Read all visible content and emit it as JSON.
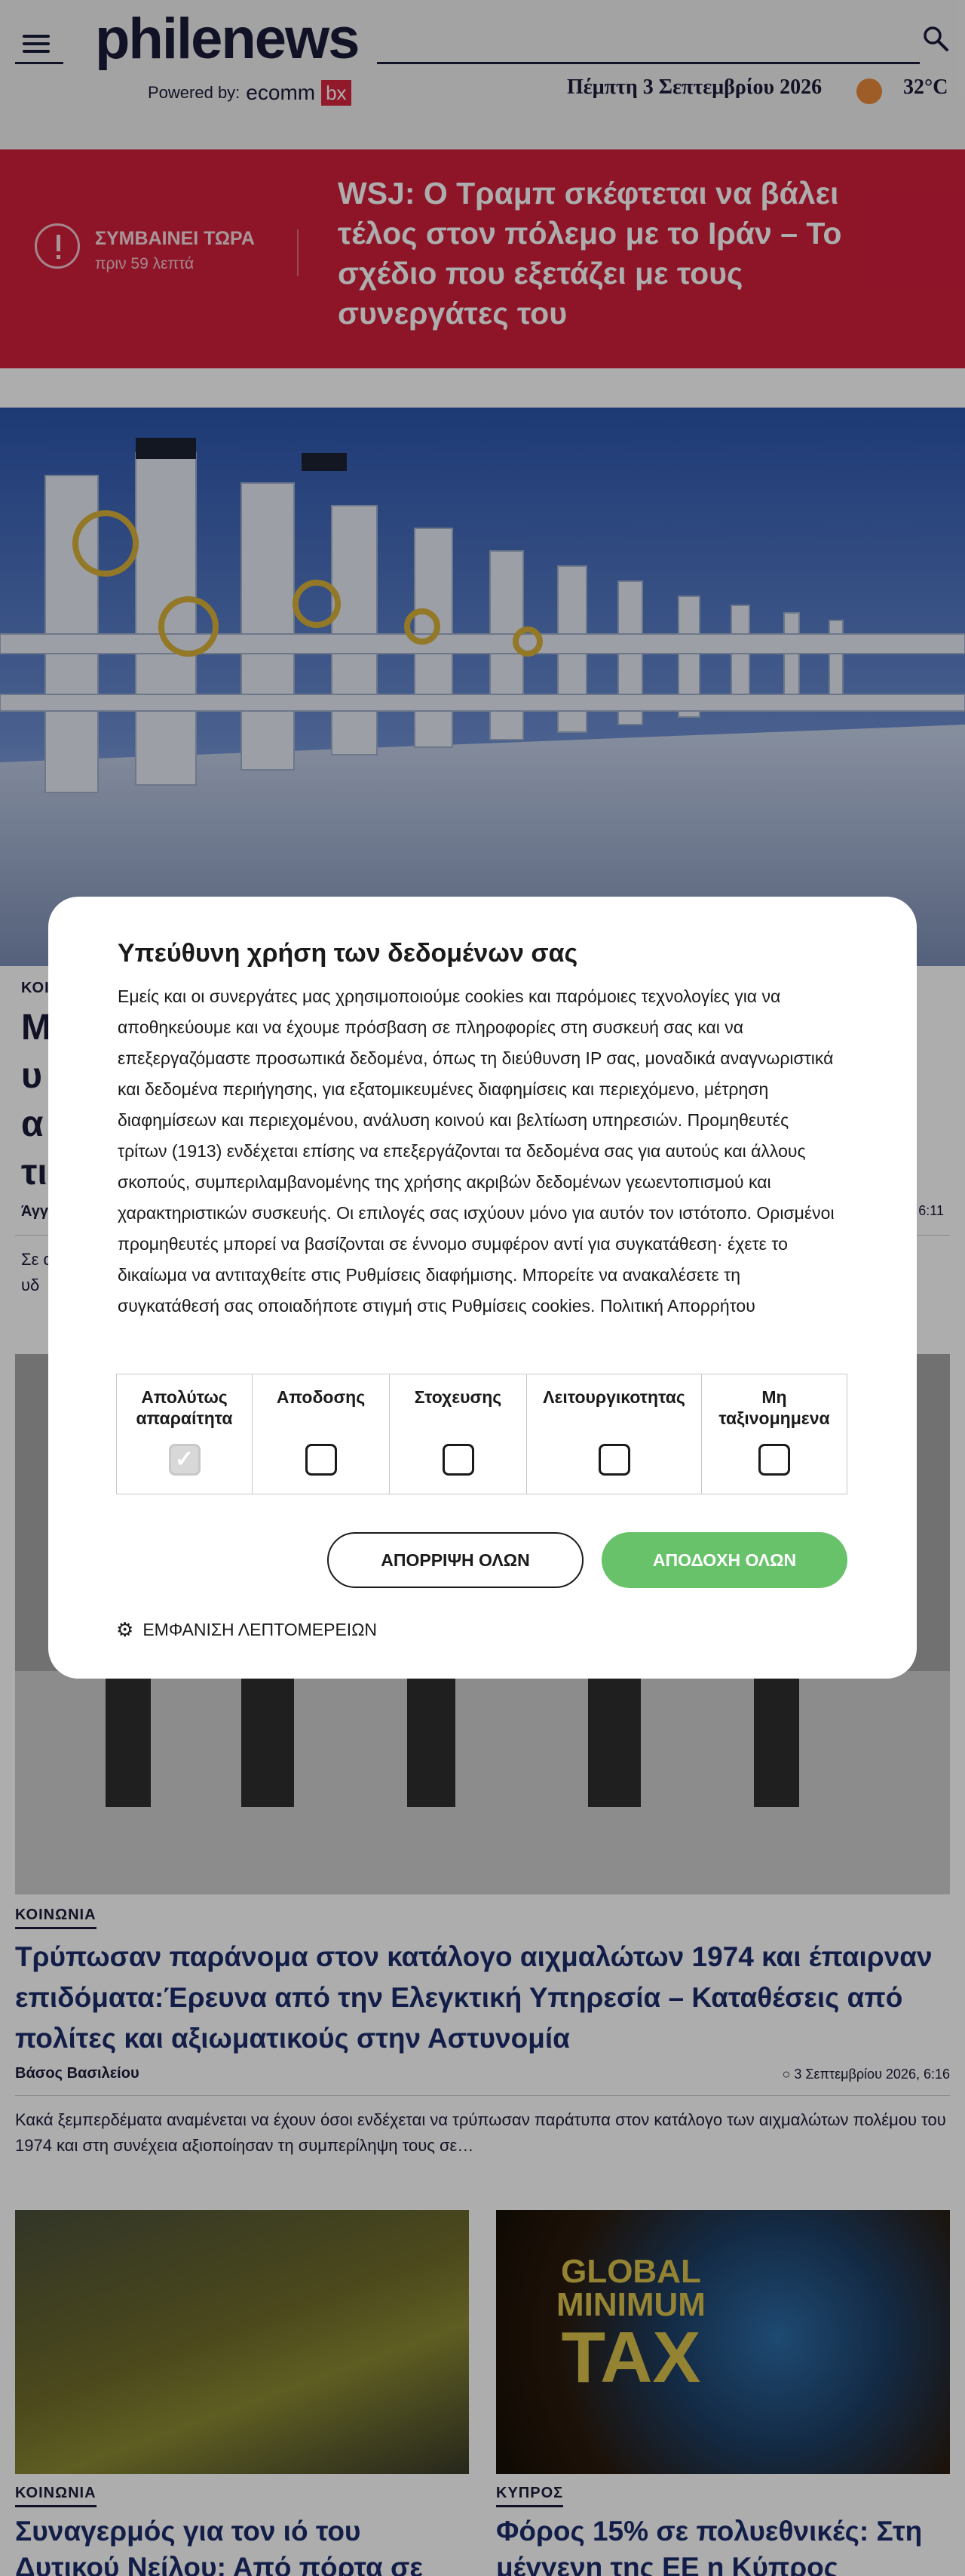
{
  "header": {
    "logo": "philenews",
    "powered_by": "Powered by:",
    "sponsor_main": "ecomm",
    "sponsor_badge": "bx",
    "date": "Πέμπτη 3 Σεπτεμβρίου 2026",
    "temperature": "32°C"
  },
  "breaking": {
    "label": "ΣΥΜΒΑΙΝΕΙ ΤΩΡΑ",
    "time": "πριν 59 λεπτά",
    "headline": "WSJ: Ο Τραμπ σκέφτεται να βάλει τέλος στον πόλεμο με το Ιράν – Το σχέδιο που εξετάζει με τους συνεργάτες του"
  },
  "article_main": {
    "category": "ΚΟΙ",
    "title": "Μ\nυ\nα\nτι",
    "author": "Άγγ",
    "time": "6:11",
    "excerpt": "Σε α\nυδ"
  },
  "article_second": {
    "category": "ΚΟΙΝΩΝΙΑ",
    "title": "Τρύπωσαν παράνομα στον κατάλογο αιχμαλώτων 1974 και έπαιρναν επιδόματα:Έρευνα από την Ελεγκτική Υπηρεσία – Καταθέσεις από πολίτες και αξιωματικούς στην Αστυνομία",
    "author": "Βάσος Βασιλείου",
    "time": "3 Σεπτεμβρίου 2026, 6:16",
    "excerpt": "Κακά ξεμπερδέματα αναμένεται να έχουν όσοι ενδέχεται να τρύπωσαν παράτυπα στον κατάλογο των αιχμαλώτων πολέμου του 1974 και στη συνέχεια αξιοποίησαν τη συμπερίληψη τους σε…"
  },
  "cards": [
    {
      "category": "ΚΟΙΝΩΝΙΑ",
      "title": "Συναγερμός για τον ιό του Δυτικού Νείλου: Από πόρτα σε"
    },
    {
      "category": "ΚΥΠΡΟΣ",
      "title": "Φόρος 15% σε πολυεθνικές: Στη μέγγενη της ΕΕ η Κύπρος",
      "image_text": [
        "GLOBAL",
        "MINIMUM",
        "TAX"
      ]
    }
  ],
  "cookie_modal": {
    "title": "Υπεύθυνη χρήση των δεδομένων σας",
    "text": "Εμείς και οι συνεργάτες μας χρησιμοποιούμε cookies και παρόμοιες τεχνολογίες για να αποθηκεύουμε και να έχουμε πρόσβαση σε πληροφορίες στη συσκευή σας και να επεξεργαζόμαστε προσωπικά δεδομένα, όπως τη διεύθυνση IP σας, μοναδικά αναγνωριστικά και δεδομένα περιήγησης, για εξατομικευμένες διαφημίσεις και περιεχόμενο, μέτρηση διαφημίσεων και περιεχομένου, ανάλυση κοινού και βελτίωση υπηρεσιών. Προμηθευτές τρίτων (1913) ενδέχεται επίσης να επεξεργάζονται τα δεδομένα σας για αυτούς και άλλους σκοπούς, συμπεριλαμβανομένης της χρήσης ακριβών δεδομένων γεωεντοπισμού και χαρακτηριστικών συσκευής. Οι επιλογές σας ισχύουν μόνο για αυτόν τον ιστότοπο. Ορισμένοι προμηθευτές μπορεί να βασίζονται σε έννομο συμφέρον αντί για συγκατάθεση· έχετε το δικαίωμα να αντιταχθείτε στις Ρυθμίσεις διαφήμισης. Μπορείτε να ανακαλέσετε τη συγκατάθεσή σας οποιαδήποτε στιγμή στις Ρυθμίσεις cookies. Πολιτική Απορρήτου",
    "categories": [
      {
        "label": "Απολύτως απαραίτητα",
        "checked": true
      },
      {
        "label": "Αποδοσης",
        "checked": false
      },
      {
        "label": "Στοχευσης",
        "checked": false
      },
      {
        "label": "Λειτουργικοτητας",
        "checked": false
      },
      {
        "label": "Μη ταξινομημενα",
        "checked": false
      }
    ],
    "reject_label": "ΑΠΟΡΡΙΨΗ ΟΛΩΝ",
    "accept_label": "ΑΠΟΔΟΧΗ ΟΛΩΝ",
    "details_label": "ΕΜΦΑΝΙΣΗ ΛΕΠΤΟΜΕΡΕΙΩΝ"
  },
  "colors": {
    "brand_navy": "#1b1b3a",
    "breaking_red": "#d21f3c",
    "accept_green": "#67c26a",
    "title_blue": "#1b2c6b"
  },
  "icons": [
    "hamburger-icon",
    "search-icon",
    "weather-sun-icon",
    "alert-icon",
    "gear-icon",
    "checkmark-icon"
  ]
}
